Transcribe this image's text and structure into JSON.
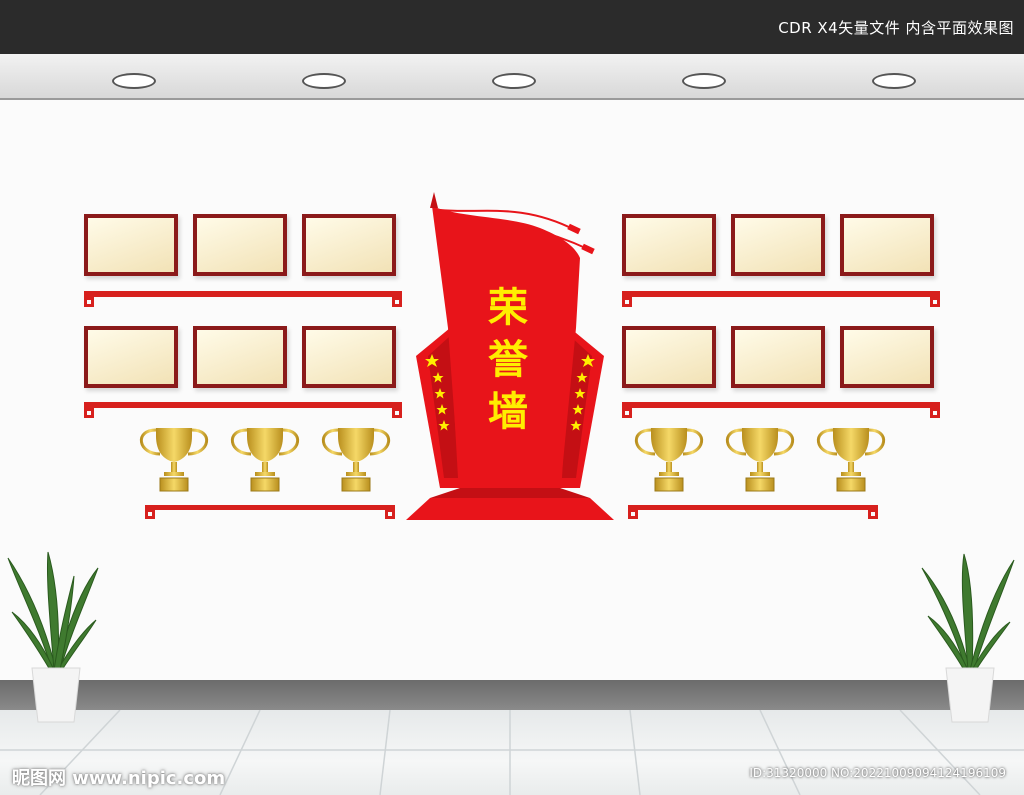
{
  "header": {
    "label": "CDR X4矢量文件  内含平面效果图"
  },
  "banner": {
    "title": "荣誉墙"
  },
  "watermark": {
    "site": "昵图网 www.nipic.com",
    "id_text": "ID:31320000 NO:20221009094124196109"
  },
  "colors": {
    "topbar": "#2b2b2b",
    "banner_red": "#e8141a",
    "frame_border": "#8b1a1a",
    "title_yellow": "#ffee00",
    "trophy_gold": "#d8b33a"
  },
  "icons": {
    "trophy": "trophy-icon",
    "star": "star-icon",
    "plant": "plant-icon"
  }
}
